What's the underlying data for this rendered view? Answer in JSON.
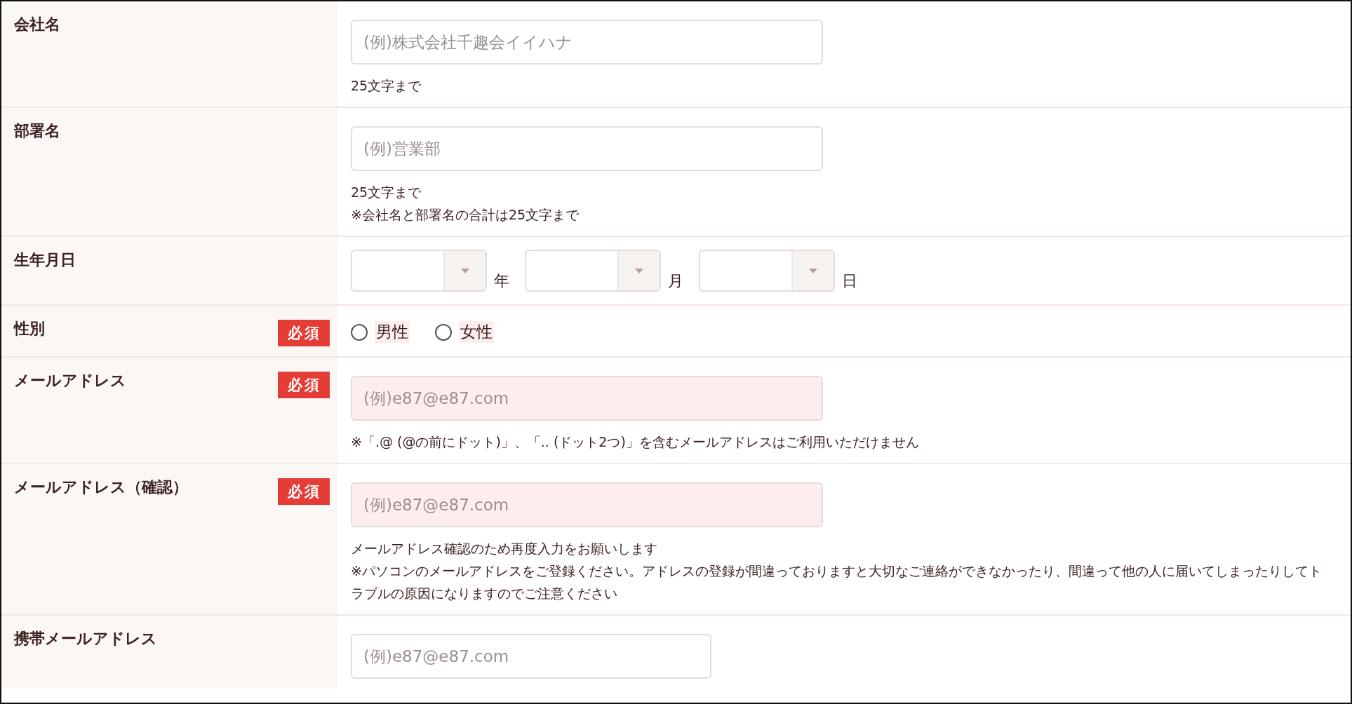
{
  "rows": [
    {
      "label": "会社名",
      "kind": "text",
      "placeholder": "(例)株式会社千趣会イイハナ",
      "notes": [
        "25文字まで"
      ]
    },
    {
      "label": "部署名",
      "kind": "text",
      "placeholder": "(例)営業部",
      "notes": [
        "25文字まで",
        "※会社名と部署名の合計は25文字まで"
      ]
    },
    {
      "label": "生年月日",
      "kind": "date",
      "selects": [
        {
          "unit": "年"
        },
        {
          "unit": "月"
        },
        {
          "unit": "日"
        }
      ]
    },
    {
      "label": "性別",
      "badge": "必須",
      "kind": "radio",
      "options": [
        {
          "label": "男性",
          "selected": false
        },
        {
          "label": "女性",
          "selected": false
        }
      ]
    },
    {
      "label": "メールアドレス",
      "badge": "必須",
      "kind": "text",
      "placeholder": "(例)e87@e87.com",
      "notes": [
        "※「.@ (@の前にドット)」、「.. (ドット2つ)」を含むメールアドレスはご利用いただけません"
      ]
    },
    {
      "label": "メールアドレス（確認）",
      "badge": "必須",
      "kind": "text",
      "placeholder": "(例)e87@e87.com",
      "notes": [
        "メールアドレス確認のため再度入力をお願いします",
        "※パソコンのメールアドレスをご登録ください。アドレスの登録が間違っておりますと大切なご連絡ができなかったり、間違って他の人に届いてしまったりしてトラブルの原因になりますのでご注意ください"
      ]
    },
    {
      "label": "携帯メールアドレス",
      "kind": "short-text",
      "placeholder": "(例)e87@e87.com"
    }
  ]
}
